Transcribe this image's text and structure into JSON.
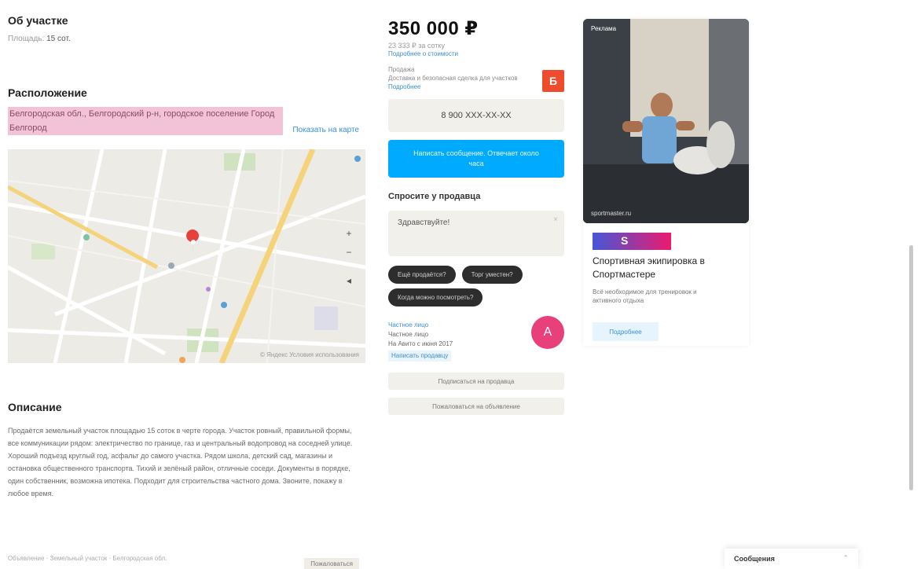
{
  "about": {
    "title": "Об участке",
    "row_label": "Площадь",
    "row_value": "15 сот."
  },
  "location": {
    "title": "Расположение",
    "address": "Белгородская обл., Белгородский р-н, городское поселение Город Белгород",
    "map_link": "Показать на карте"
  },
  "map": {
    "zoom_in": "+",
    "zoom_out": "−",
    "locate": "◂",
    "footer": "© Яндекс  Условия использования"
  },
  "description": {
    "title": "Описание",
    "text": "Продаётся земельный участок площадью 15 соток в черте города. Участок ровный, правильной формы, все коммуникации рядом: электричество по границе, газ и центральный водопровод на соседней улице. Хороший подъезд круглый год, асфальт до самого участка. Рядом школа, детский сад, магазины и остановка общественного транспорта. Тихий и зелёный район, отличные соседи. Документы в порядке, один собственник, возможна ипотека. Подходит для строительства частного дома. Звоните, покажу в любое время."
  },
  "bottom_bar": {
    "text": "Объявление · Земельный участок · Белгородская обл.",
    "button": "Пожаловаться"
  },
  "offer": {
    "price": "350 000 ₽",
    "price_per": "23 333 ₽ за сотку",
    "price_link": "Подробнее о стоимости",
    "sale_label": "Продажа",
    "sale_text": "Доставка и безопасная сделка для участков",
    "sale_link": "Подробнее",
    "sale_badge": "Б",
    "phone_button": "8 900 ХХХ-ХХ-ХХ",
    "message_button": "Написать сообщение. Отвечает около часа"
  },
  "ask": {
    "title": "Спросите у продавца",
    "input_value": "Здравствуйте!",
    "close": "×",
    "chips": [
      "Ещё продаётся?",
      "Торг уместен?",
      "Когда можно посмотреть?"
    ]
  },
  "seller": {
    "name": "Частное лицо",
    "type": "Частное лицо",
    "since": "На Авито с июня 2017",
    "link": "Написать продавцу",
    "avatar_letter": "А",
    "btn_subscribe": "Подписаться на продавца",
    "btn_complain": "Пожаловаться на объявление"
  },
  "ad": {
    "tag": "Реклама",
    "watermark": "sportmaster.ru",
    "logo_text": "S",
    "title": "Спортивная экипировка в Спортмастере",
    "text": "Всё необходимое для тренировок и активного отдыха",
    "button": "Подробнее"
  },
  "messages": {
    "label": "Сообщения",
    "chevron": "⌃"
  },
  "colors": {
    "accent_blue": "#00aaff",
    "sale_red": "#ee4d2d",
    "avatar_pink": "#e8407a",
    "address_highlight": "#f2c3d6"
  }
}
